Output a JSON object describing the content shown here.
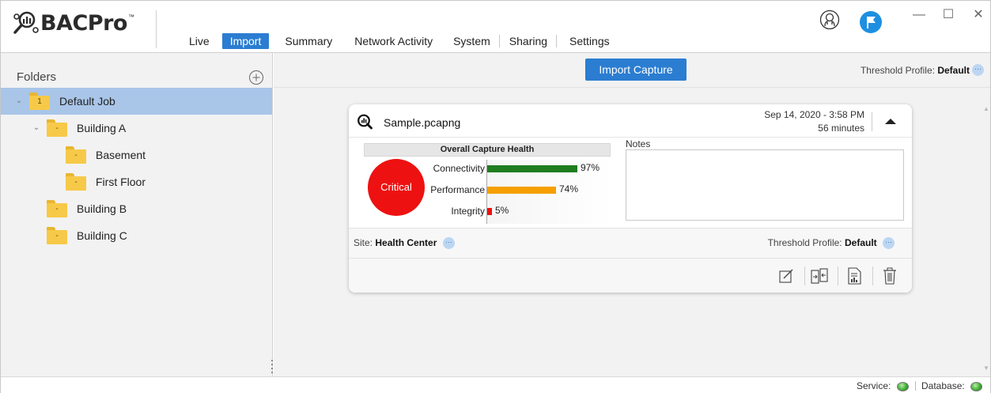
{
  "app": {
    "logo_text": "BACPro",
    "logo_tm": "™"
  },
  "nav": {
    "tabs": [
      {
        "label": "Live",
        "active": false
      },
      {
        "label": "Import",
        "active": true
      },
      {
        "label": "Summary",
        "active": false
      },
      {
        "label": "Network Activity",
        "active": false
      },
      {
        "label": "System",
        "active": false
      },
      {
        "label": "Sharing",
        "active": false
      },
      {
        "label": "Settings",
        "active": false
      }
    ]
  },
  "window_controls": {
    "minimize": "—",
    "maximize": "☐",
    "close": "✕"
  },
  "sidebar": {
    "header": "Folders",
    "items": [
      {
        "label": "Default Job",
        "count": "1",
        "expanded": true,
        "selected": true
      },
      {
        "label": "Building A",
        "count": "-",
        "expanded": true,
        "selected": false
      },
      {
        "label": "Basement",
        "count": "-",
        "selected": false
      },
      {
        "label": "First Floor",
        "count": "-",
        "selected": false
      },
      {
        "label": "Building B",
        "count": "-",
        "selected": false
      },
      {
        "label": "Building C",
        "count": "-",
        "selected": false
      }
    ]
  },
  "toolbar": {
    "import_label": "Import Capture",
    "threshold_label": "Threshold Profile:",
    "threshold_value": "Default",
    "more_label": "···"
  },
  "capture": {
    "filename": "Sample.pcapng",
    "date": "Sep 14, 2020 - 3:58 PM",
    "duration": "56 minutes",
    "health_title": "Overall Capture Health",
    "status": "Critical",
    "metrics": [
      {
        "label": "Connectivity",
        "value": 97,
        "display": "97%",
        "color": "#1f7d1f"
      },
      {
        "label": "Performance",
        "value": 74,
        "display": "74%",
        "color": "#f5a000"
      },
      {
        "label": "Integrity",
        "value": 5,
        "display": "5%",
        "color": "#ee1111"
      }
    ],
    "notes_label": "Notes",
    "notes_value": "",
    "site_label": "Site:",
    "site_value": "Health Center",
    "threshold_label": "Threshold Profile:",
    "threshold_value": "Default",
    "more_label": "···"
  },
  "statusbar": {
    "service_label": "Service:",
    "database_label": "Database:",
    "ok_color": "#3aa82c"
  },
  "colors": {
    "accent": "#2b7dd1",
    "selection": "#a9c5e8",
    "folder": "#f7c948",
    "critical": "#ee1111"
  }
}
